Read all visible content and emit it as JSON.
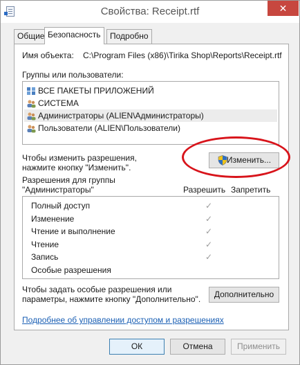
{
  "window": {
    "title": "Свойства: Receipt.rtf",
    "close_symbol": "✕"
  },
  "tabs": [
    {
      "label": "Общие"
    },
    {
      "label": "Безопасность"
    },
    {
      "label": "Подробно"
    }
  ],
  "object": {
    "label": "Имя объекта:",
    "value": "C:\\Program Files (x86)\\Tirika Shop\\Reports\\Receipt.rtf"
  },
  "groups": {
    "label": "Группы или пользователи:",
    "items": [
      {
        "name": "ВСЕ ПАКЕТЫ ПРИЛОЖЕНИЙ",
        "icon": "app-packages-icon"
      },
      {
        "name": "СИСТЕМА",
        "icon": "users-icon"
      },
      {
        "name": "Администраторы (ALIEN\\Администраторы)",
        "icon": "users-icon",
        "selected": true
      },
      {
        "name": "Пользователи (ALIEN\\Пользователи)",
        "icon": "users-icon"
      }
    ]
  },
  "change": {
    "hint_line1": "Чтобы изменить разрешения,",
    "hint_line2": "нажмите кнопку \"Изменить\".",
    "button_label": "Изменить...",
    "button_icon": "shield-icon"
  },
  "permissions": {
    "title_line1": "Разрешения для группы",
    "title_line2": "\"Администраторы\"",
    "allow_label": "Разрешить",
    "deny_label": "Запретить",
    "check_symbol": "✓",
    "rows": [
      {
        "name": "Полный доступ",
        "allow": true
      },
      {
        "name": "Изменение",
        "allow": true
      },
      {
        "name": "Чтение и выполнение",
        "allow": true
      },
      {
        "name": "Чтение",
        "allow": true
      },
      {
        "name": "Запись",
        "allow": true
      },
      {
        "name": "Особые разрешения",
        "allow": false
      }
    ]
  },
  "advanced": {
    "hint_line1": "Чтобы задать особые разрешения или",
    "hint_line2": "параметры, нажмите кнопку \"Дополнительно\".",
    "button_label": "Дополнительно"
  },
  "link_text": "Подробнее об управлении доступом и разрешениях",
  "footer": {
    "ok_label": "ОК",
    "cancel_label": "Отмена",
    "apply_label": "Применить"
  },
  "colors": {
    "highlight_ellipse": "#d8141b",
    "link": "#1a5fb4",
    "close_button": "#c7473f"
  }
}
